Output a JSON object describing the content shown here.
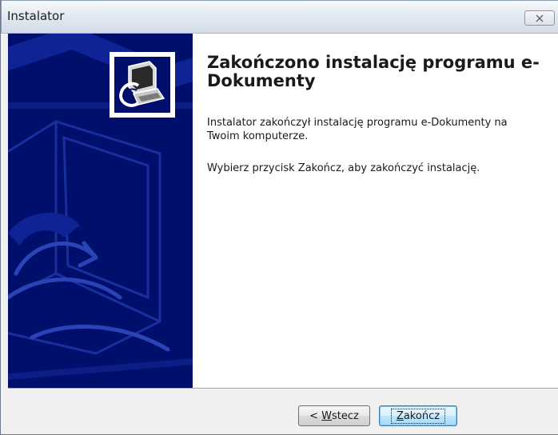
{
  "window": {
    "title": "Instalator"
  },
  "content": {
    "heading": "Zakończono instalację programu e-Dokumenty",
    "description": "Instalator zakończył instalację programu e-Dokumenty na Twoim komputerze.",
    "instruction": "Wybierz przycisk Zakończ, aby zakończyć instalację."
  },
  "buttons": {
    "back": {
      "prefix": "< ",
      "mnemonic": "W",
      "rest": "stecz"
    },
    "finish": {
      "mnemonic": "Z",
      "rest": "akończ"
    }
  },
  "colors": {
    "sidebar": "#000f6c",
    "sidebar_art": "#1a2f9e",
    "accent_focus": "#3c7fb1"
  },
  "icons": {
    "close": "close-icon",
    "installer": "computer-install-icon"
  }
}
